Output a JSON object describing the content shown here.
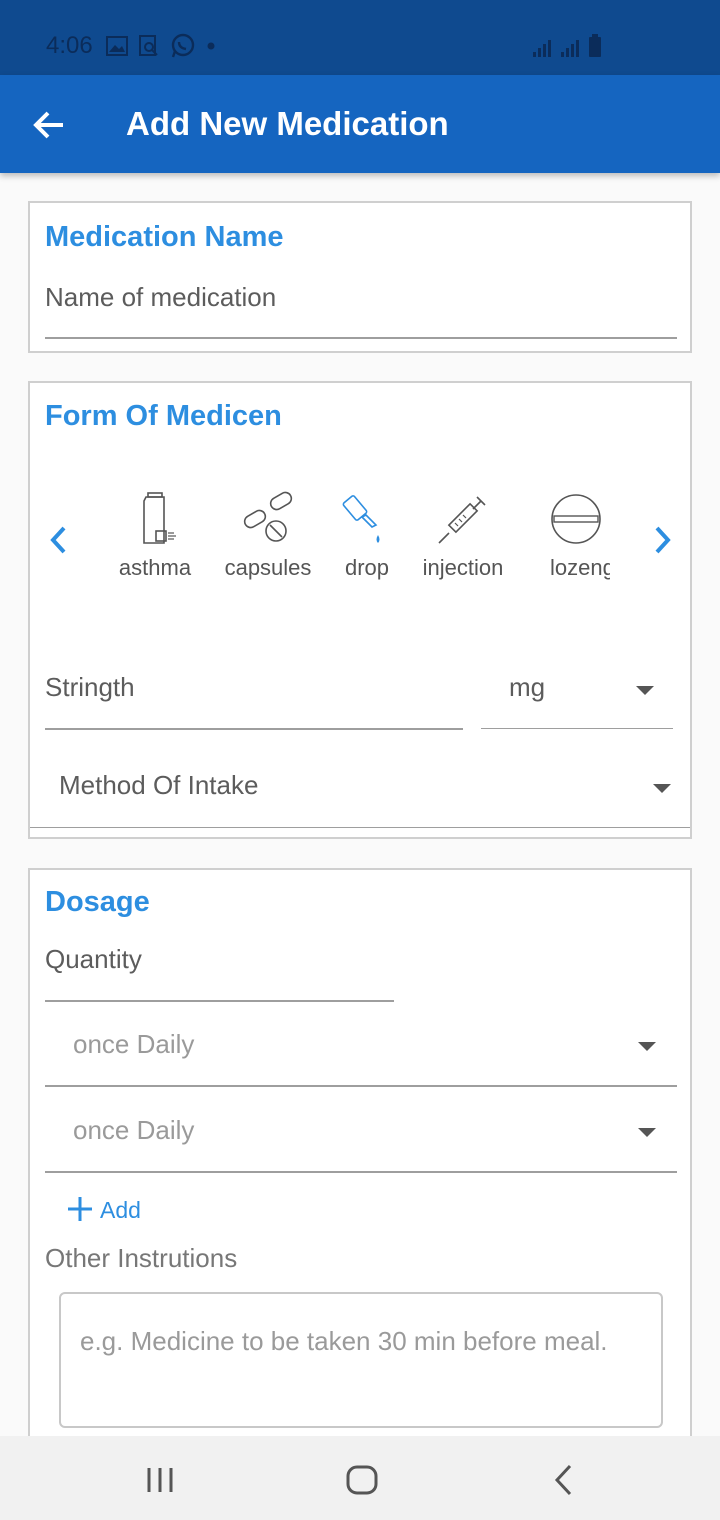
{
  "status": {
    "time": "4:06"
  },
  "app_bar": {
    "title": "Add New Medication"
  },
  "medication_name": {
    "title": "Medication Name",
    "placeholder": "Name of medication"
  },
  "form": {
    "title": "Form Of Medicen",
    "items": [
      {
        "label": "asthma",
        "icon": "inhaler-icon"
      },
      {
        "label": "capsules",
        "icon": "capsules-icon"
      },
      {
        "label": "drop",
        "icon": "drop-icon"
      },
      {
        "label": "injection",
        "icon": "syringe-icon"
      },
      {
        "label": "lozeng",
        "icon": "lozenge-icon"
      }
    ],
    "selected": "drop",
    "strength_placeholder": "Stringth",
    "unit": "mg",
    "method_placeholder": "Method Of Intake"
  },
  "dosage": {
    "title": "Dosage",
    "quantity_placeholder": "Quantity",
    "frequency_1": "once Daily",
    "frequency_2": "once Daily",
    "add_label": "Add",
    "other_label": "Other Instrutions",
    "instructions_placeholder": "e.g. Medicine to be taken 30 min before meal."
  },
  "colors": {
    "primary": "#1565c0",
    "status_bar": "#0f4a8f",
    "accent": "#2d8ee0"
  }
}
